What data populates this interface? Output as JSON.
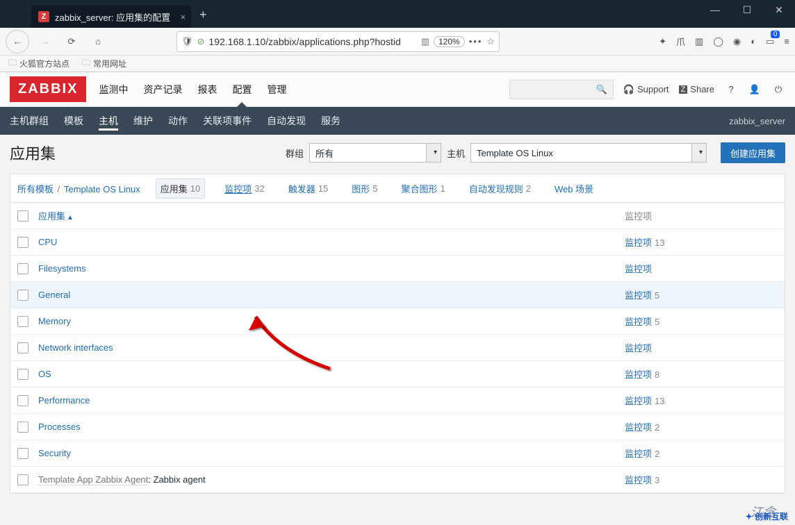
{
  "browser": {
    "tab_title": "zabbix_server: 应用集的配置",
    "tab_favicon": "Z",
    "url": "192.168.1.10/zabbix/applications.php?hostid",
    "zoom": "120%",
    "bookmarks": [
      {
        "label": "火狐官方站点"
      },
      {
        "label": "常用网址"
      }
    ],
    "container_badge": "0"
  },
  "zabbix": {
    "logo": "ZABBIX",
    "topnav": [
      "监测中",
      "资产记录",
      "报表",
      "配置",
      "管理"
    ],
    "topnav_active": "配置",
    "subnav": [
      "主机群组",
      "模板",
      "主机",
      "维护",
      "动作",
      "关联项事件",
      "自动发现",
      "服务"
    ],
    "subnav_active": "主机",
    "current_host": "zabbix_server",
    "header_links": {
      "support": "Support",
      "share": "Share"
    }
  },
  "page": {
    "title": "应用集",
    "group_label": "群组",
    "group_value": "所有",
    "host_label": "主机",
    "host_value": "Template OS Linux",
    "create_btn": "创建应用集"
  },
  "crumbs": {
    "all_templates": "所有模板",
    "template_name": "Template OS Linux",
    "tabs": [
      {
        "label": "应用集",
        "count": "10",
        "active": true
      },
      {
        "label": "监控项",
        "count": "32"
      },
      {
        "label": "触发器",
        "count": "15"
      },
      {
        "label": "图形",
        "count": "5"
      },
      {
        "label": "聚合图形",
        "count": "1"
      },
      {
        "label": "自动发现规则",
        "count": "2"
      },
      {
        "label": "Web 场景",
        "count": ""
      }
    ]
  },
  "table": {
    "col_app": "应用集",
    "col_items": "监控项",
    "items_label": "监控项",
    "rows": [
      {
        "name": "CPU",
        "count": "13"
      },
      {
        "name": "Filesystems",
        "count": ""
      },
      {
        "name": "General",
        "count": "5",
        "hover": true
      },
      {
        "name": "Memory",
        "count": "5"
      },
      {
        "name": "Network interfaces",
        "count": ""
      },
      {
        "name": "OS",
        "count": "8"
      },
      {
        "name": "Performance",
        "count": "13"
      },
      {
        "name": "Processes",
        "count": "2"
      },
      {
        "name": "Security",
        "count": "2"
      },
      {
        "name_prefix": "Template App Zabbix Agent",
        "name_suffix": ": Zabbix agent",
        "count": "3",
        "gray": true
      }
    ]
  },
  "watermark": {
    "a": "江念…",
    "b": "创新互联"
  }
}
